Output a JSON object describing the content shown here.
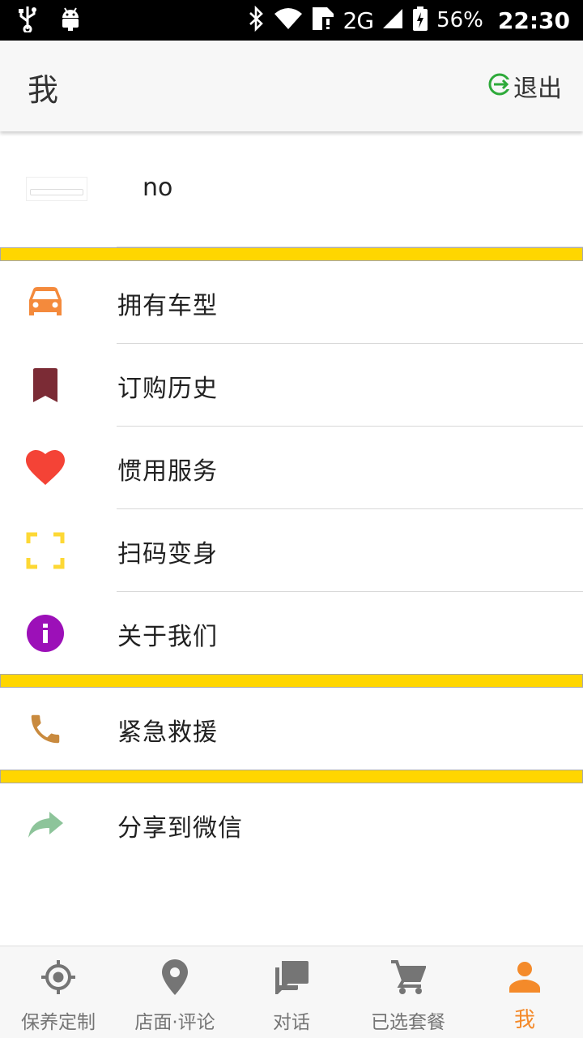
{
  "status_bar": {
    "network": "2G",
    "battery": "56%",
    "time": "22:30"
  },
  "app_bar": {
    "title": "我",
    "logout_label": "退出"
  },
  "profile": {
    "username": "no"
  },
  "menu": {
    "items": [
      {
        "label": "拥有车型",
        "icon": "car-icon",
        "color": "#f48a3c"
      },
      {
        "label": "订购历史",
        "icon": "bookmark-icon",
        "color": "#7b2b35"
      },
      {
        "label": "惯用服务",
        "icon": "heart-icon",
        "color": "#f44336"
      },
      {
        "label": "扫码变身",
        "icon": "scan-icon",
        "color": "#fdd835"
      },
      {
        "label": "关于我们",
        "icon": "info-icon",
        "color": "#9c10b8"
      },
      {
        "label": "紧急救援",
        "icon": "phone-icon",
        "color": "#c98a3e"
      },
      {
        "label": "分享到微信",
        "icon": "share-icon",
        "color": "#8dc49a"
      }
    ]
  },
  "bottom_nav": {
    "items": [
      {
        "label": "保养定制",
        "icon": "target-icon"
      },
      {
        "label": "店面·评论",
        "icon": "location-pin-icon"
      },
      {
        "label": "对话",
        "icon": "chat-icon"
      },
      {
        "label": "已选套餐",
        "icon": "cart-icon"
      },
      {
        "label": "我",
        "icon": "person-icon"
      }
    ],
    "active_color": "#f48a2a",
    "inactive_color": "#757575"
  },
  "colors": {
    "separator": "#ffd600",
    "logout_icon": "#2eaa3a"
  }
}
